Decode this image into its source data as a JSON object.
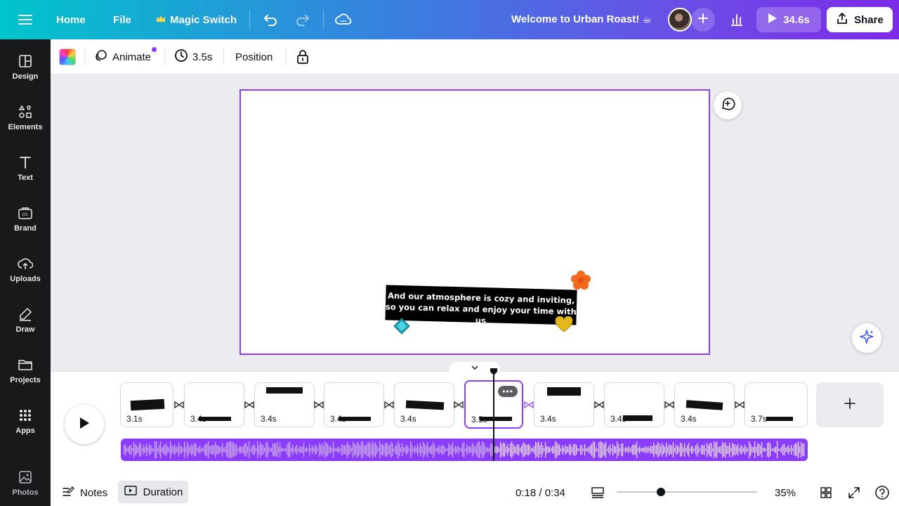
{
  "topbar": {
    "home": "Home",
    "file": "File",
    "magic_switch": "Magic Switch",
    "doc_title": "Welcome to Urban Roast! ☕",
    "play_duration": "34.6s",
    "share": "Share"
  },
  "sidebar": {
    "items": [
      {
        "label": "Design",
        "icon": "design-icon"
      },
      {
        "label": "Elements",
        "icon": "elements-icon"
      },
      {
        "label": "Text",
        "icon": "text-icon"
      },
      {
        "label": "Brand",
        "icon": "brand-icon"
      },
      {
        "label": "Uploads",
        "icon": "uploads-icon"
      },
      {
        "label": "Draw",
        "icon": "draw-icon"
      },
      {
        "label": "Projects",
        "icon": "projects-icon"
      },
      {
        "label": "Apps",
        "icon": "apps-icon"
      },
      {
        "label": "Photos",
        "icon": "photos-icon"
      }
    ]
  },
  "context_toolbar": {
    "animate": "Animate",
    "duration": "3.5s",
    "position": "Position"
  },
  "canvas": {
    "caption": "And our atmosphere is cozy and inviting, so you can relax and enjoy your time with us"
  },
  "timeline": {
    "pages": [
      {
        "duration": "3.1s"
      },
      {
        "duration": "3.4s"
      },
      {
        "duration": "3.4s"
      },
      {
        "duration": "3.4s"
      },
      {
        "duration": "3.4s"
      },
      {
        "duration": "3.5s",
        "active": true
      },
      {
        "duration": "3.4s"
      },
      {
        "duration": "3.4s"
      },
      {
        "duration": "3.4s"
      },
      {
        "duration": "3.7s"
      }
    ]
  },
  "bottombar": {
    "notes": "Notes",
    "duration": "Duration",
    "time": "0:18 / 0:34",
    "zoom": "35%"
  },
  "colors": {
    "accent": "#8b3dff",
    "sidebar_bg": "#18191b",
    "gradient_start": "#00c4cc",
    "gradient_end": "#7d2ae8"
  }
}
